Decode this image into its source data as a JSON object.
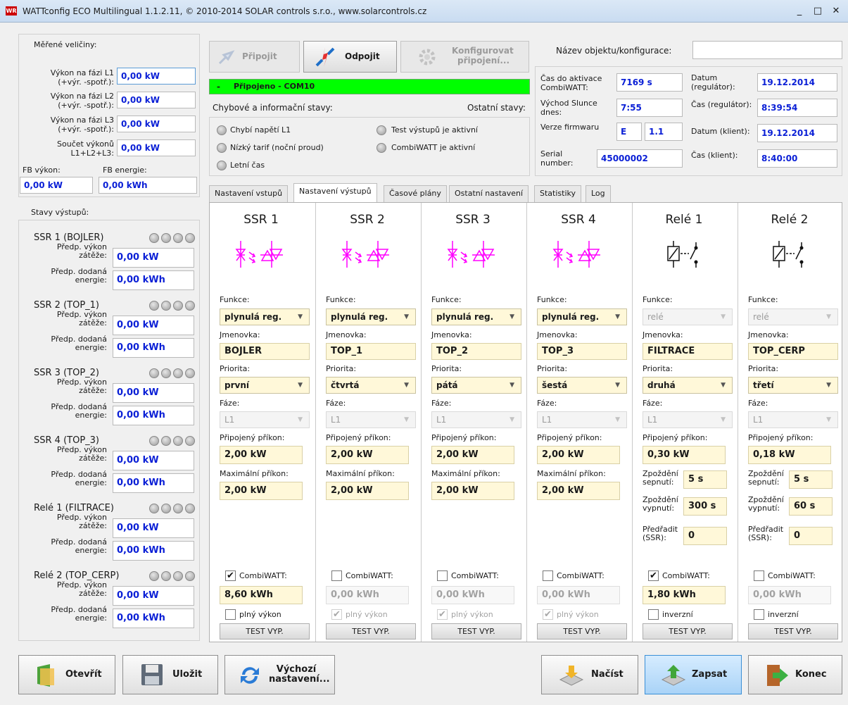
{
  "window": {
    "title": "WATTconfig ECO Multilingual 1.1.2.11, © 2010-2014 SOLAR controls s.r.o., www.solarcontrols.cz",
    "logo_text": "WR",
    "minimize": "_",
    "maximize": "□",
    "close": "✕"
  },
  "measured": {
    "title": "Měřené veličiny:",
    "rows": [
      {
        "label": "Výkon na fázi L1 (+výr. -spotř.):",
        "value": "0,00 kW"
      },
      {
        "label": "Výkon na fázi L2 (+výr. -spotř.):",
        "value": "0,00 kW"
      },
      {
        "label": "Výkon na fázi L3 (+výr. -spotř.):",
        "value": "0,00 kW"
      },
      {
        "label": "Součet výkonů L1+L2+L3:",
        "value": "0,00 kW"
      }
    ],
    "fb_power_label": "FB výkon:",
    "fb_power_value": "0,00 kW",
    "fb_energy_label": "FB energie:",
    "fb_energy_value": "0,00 kWh"
  },
  "outputs_state": {
    "title": "Stavy výstupů:",
    "power_label": "Předp. výkon zátěže:",
    "energy_label": "Předp. dodaná energie:",
    "items": [
      {
        "name": "SSR 1 (BOJLER)",
        "power": "0,00 kW",
        "energy": "0,00 kWh"
      },
      {
        "name": "SSR 2 (TOP_1)",
        "power": "0,00 kW",
        "energy": "0,00 kWh"
      },
      {
        "name": "SSR 3 (TOP_2)",
        "power": "0,00 kW",
        "energy": "0,00 kWh"
      },
      {
        "name": "SSR 4 (TOP_3)",
        "power": "0,00 kW",
        "energy": "0,00 kWh"
      },
      {
        "name": "Relé 1 (FILTRACE)",
        "power": "0,00 kW",
        "energy": "0,00 kWh"
      },
      {
        "name": "Relé 2 (TOP_CERP)",
        "power": "0,00 kW",
        "energy": "0,00 kWh"
      }
    ]
  },
  "connection": {
    "connect": "Připojit",
    "disconnect": "Odpojit",
    "configure_1": "Konfigurovat",
    "configure_2": "připojení...",
    "status_dash": "-",
    "status": "Připojeno - COM10",
    "status_color": "#00ff00"
  },
  "info": {
    "title": "Chybové a informační stavy:",
    "other_title": "Ostatní stavy:",
    "items": [
      "Chybí napětí L1",
      "Nízký tarif (noční proud)",
      "Letní čas"
    ],
    "other_items": [
      "Test výstupů je aktivní",
      "CombiWATT je aktivní"
    ]
  },
  "object": {
    "label": "Název objektu/konfigurace:",
    "value": ""
  },
  "device": {
    "combi_label_1": "Čas do aktivace",
    "combi_label_2": "CombiWATT:",
    "combi": "7169 s",
    "sunrise_label_1": "Východ Slunce",
    "sunrise_label_2": "dnes:",
    "sunrise": "7:55",
    "fw_label": "Verze firmwaru",
    "fw_a": "E",
    "fw_b": "1.1",
    "serial_label_1": "Serial",
    "serial_label_2": "number:",
    "serial": "45000002",
    "date_reg_label_1": "Datum",
    "date_reg_label_2": "(regulátor):",
    "date_reg": "19.12.2014",
    "time_reg_label": "Čas (regulátor):",
    "time_reg": "8:39:54",
    "date_cli_label": "Datum (klient):",
    "date_cli": "19.12.2014",
    "time_cli_label": "Čas (klient):",
    "time_cli": "8:40:00"
  },
  "tabs": [
    "Nastavení vstupů",
    "Nastavení výstupů",
    "Časové plány",
    "Ostatní nastavení",
    "Statistiky",
    "Log"
  ],
  "columns_labels": {
    "funkce": "Funkce:",
    "jmenovka": "Jmenovka:",
    "priorita": "Priorita:",
    "faze": "Fáze:",
    "prikon": "Připojený příkon:",
    "max": "Maximální příkon:",
    "delay_on_1": "Zpoždění",
    "delay_on_2": "sepnutí:",
    "delay_off_1": "Zpoždění",
    "delay_off_2": "vypnutí:",
    "pre_1": "Předřadit",
    "pre_2": "(SSR):",
    "combi": "CombiWATT:",
    "full": "plný výkon",
    "inverse": "inverzní",
    "test": "TEST VYP."
  },
  "columns": [
    {
      "title": "SSR 1",
      "funkce": "plynulá reg.",
      "jmenovka": "BOJLER",
      "priorita": "první",
      "faze": "L1",
      "prikon": "2,00 kW",
      "max": "2,00 kW",
      "combi_checked": "✔",
      "combi_value": "8,60 kWh",
      "opt_checked": ""
    },
    {
      "title": "SSR 2",
      "funkce": "plynulá reg.",
      "jmenovka": "TOP_1",
      "priorita": "čtvrtá",
      "faze": "L1",
      "prikon": "2,00 kW",
      "max": "2,00 kW",
      "combi_checked": "",
      "combi_value": "0,00 kWh",
      "opt_checked": "✔"
    },
    {
      "title": "SSR 3",
      "funkce": "plynulá reg.",
      "jmenovka": "TOP_2",
      "priorita": "pátá",
      "faze": "L1",
      "prikon": "2,00 kW",
      "max": "2,00 kW",
      "combi_checked": "",
      "combi_value": "0,00 kWh",
      "opt_checked": "✔"
    },
    {
      "title": "SSR 4",
      "funkce": "plynulá reg.",
      "jmenovka": "TOP_3",
      "priorita": "šestá",
      "faze": "L1",
      "prikon": "2,00 kW",
      "max": "2,00 kW",
      "combi_checked": "",
      "combi_value": "0,00 kWh",
      "opt_checked": "✔"
    },
    {
      "title": "Relé 1",
      "funkce": "relé",
      "jmenovka": "FILTRACE",
      "priorita": "druhá",
      "faze": "L1",
      "prikon": "0,30 kW",
      "delay_on": "5 s",
      "delay_off": "300 s",
      "pre": "0",
      "combi_checked": "✔",
      "combi_value": "1,80 kWh",
      "opt_checked": ""
    },
    {
      "title": "Relé 2",
      "funkce": "relé",
      "jmenovka": "TOP_CERP",
      "priorita": "třetí",
      "faze": "L1",
      "prikon": "0,18 kW",
      "delay_on": "5 s",
      "delay_off": "60 s",
      "pre": "0",
      "combi_checked": "",
      "combi_value": "0,00 kWh",
      "opt_checked": ""
    }
  ],
  "bottom": {
    "open": "Otevřít",
    "save": "Uložit",
    "defaults_1": "Výchozí",
    "defaults_2": "nastavení...",
    "load": "Načíst",
    "write": "Zapsat",
    "exit": "Konec"
  },
  "colors": {
    "value_blue": "#0a1fd6",
    "ssr_symbol": "#ff00ff",
    "input_yellow": "#fff8d9"
  }
}
